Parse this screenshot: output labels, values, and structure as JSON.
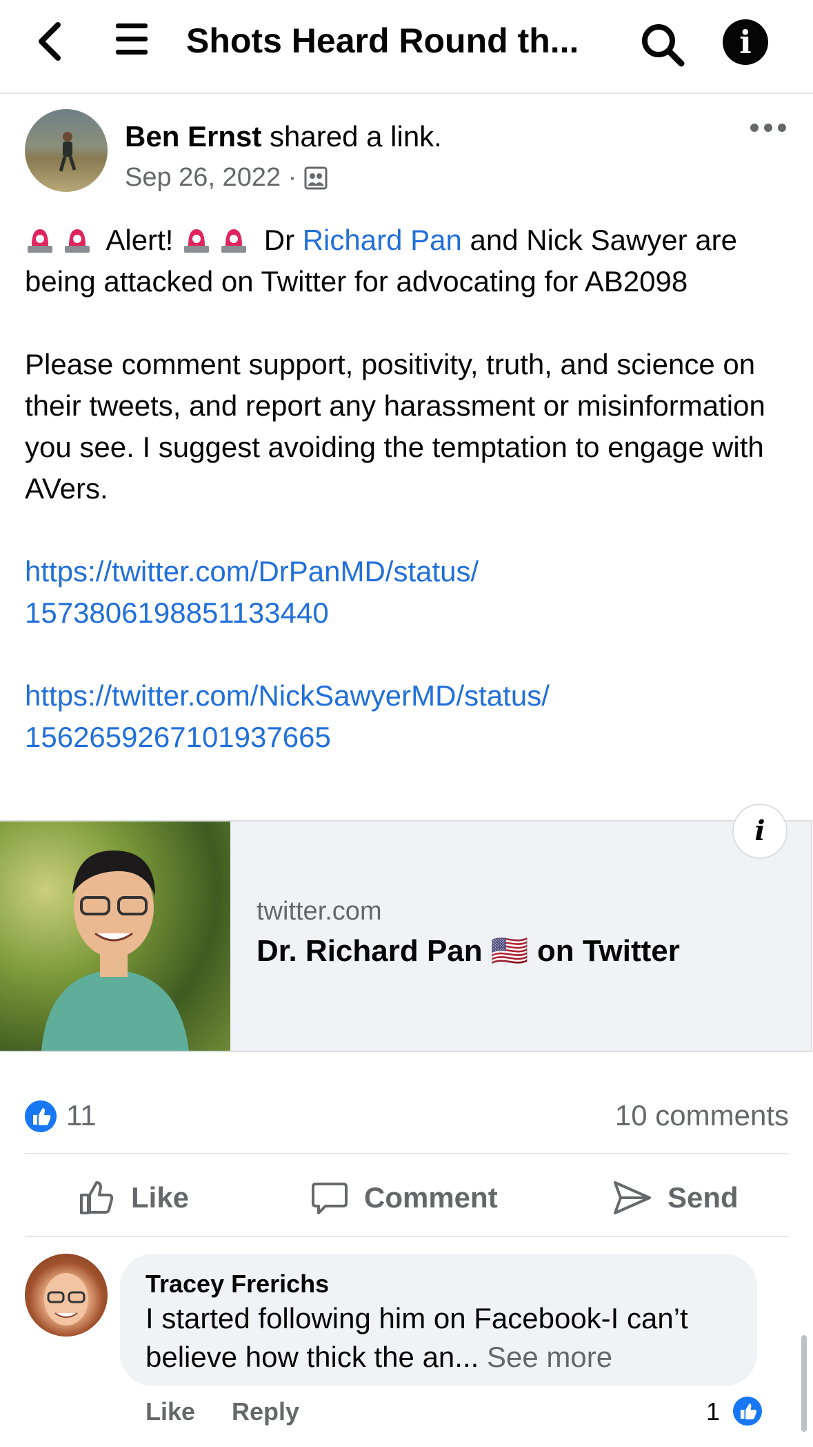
{
  "header": {
    "title": "Shots Heard Round th...",
    "back_icon": "chevron-left-icon",
    "menu_icon": "hamburger-menu-icon",
    "search_icon": "search-icon",
    "info_icon": "info-icon"
  },
  "post": {
    "author": "Ben Ernst",
    "action": " shared a link.",
    "date": "Sep 26, 2022 · ",
    "audience_icon": "group-members-icon",
    "more_icon": "more-options-icon",
    "body": {
      "alert_text": " Alert! ",
      "dr_prefix": " Dr ",
      "mention": "Richard Pan",
      "line1_rest": " and Nick Sawyer are being attacked on Twitter for advocating for AB2098",
      "paragraph2": "Please comment support, positivity, truth, and science on their tweets, and report any harassment or misinformation you see. I suggest avoiding the temptation to engage with AVers.",
      "link1_line1": "https://twitter.com/DrPanMD/status/",
      "link1_line2": "1573806198851133440",
      "link2_line1": "https://twitter.com/NickSawyerMD/status/",
      "link2_line2": "1562659267101937665"
    },
    "link_card": {
      "domain": "twitter.com",
      "title_prefix": "Dr. Richard Pan ",
      "title_flag": "🇺🇸",
      "title_suffix": " on Twitter",
      "info_label": "i"
    },
    "reactions": {
      "like_count": "11",
      "comments": "10 comments"
    },
    "actions": {
      "like": "Like",
      "comment": "Comment",
      "send": "Send"
    }
  },
  "comment": {
    "author": "Tracey Frerichs",
    "text": "I started following him on Facebook-I can’t believe how thick the an... ",
    "see_more": "See more",
    "like": "Like",
    "reply": "Reply",
    "reaction_count": "1"
  },
  "colors": {
    "link": "#216fdb",
    "facebook_blue": "#1877f2",
    "secondary_text": "#65676b"
  }
}
